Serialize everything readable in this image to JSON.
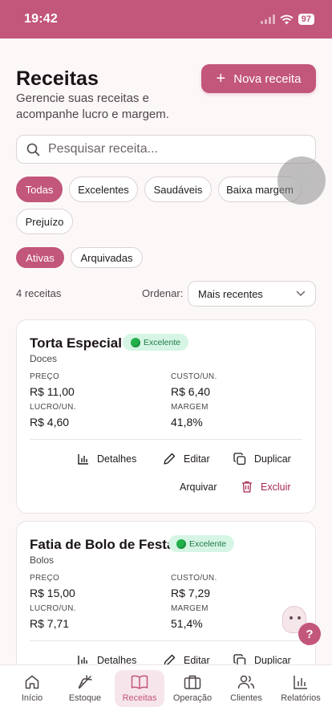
{
  "status_bar": {
    "time": "19:42",
    "battery": "97"
  },
  "header": {
    "title": "Receitas",
    "subtitle": "Gerencie suas receitas e acompanhe lucro e margem.",
    "new_button": "Nova receita"
  },
  "search": {
    "placeholder": "Pesquisar receita..."
  },
  "filters": [
    "Todas",
    "Excelentes",
    "Saudáveis",
    "Baixa margem",
    "Prejuízo"
  ],
  "active_filter": "Todas",
  "status_tabs": [
    "Ativas",
    "Arquivadas"
  ],
  "list": {
    "count": "4 receitas",
    "sort_label": "Ordenar:",
    "sort_value": "Mais recentes"
  },
  "cards": [
    {
      "name": "Torta Especial",
      "badge": "Excelente",
      "category": "Doces",
      "price_label": "PREÇO",
      "price": "R$ 11,00",
      "cost_label": "CUSTO/UN.",
      "cost": "R$ 6,40",
      "profit_label": "LUCRO/UN.",
      "profit": "R$ 4,60",
      "margin_label": "MARGEM",
      "margin": "41,8%"
    },
    {
      "name": "Fatia de Bolo de Festa",
      "badge": "Excelente",
      "category": "Bolos",
      "price_label": "PREÇO",
      "price": "R$ 15,00",
      "cost_label": "CUSTO/UN.",
      "cost": "R$ 7,29",
      "profit_label": "LUCRO/UN.",
      "profit": "R$ 7,71",
      "margin_label": "MARGEM",
      "margin": "51,4%"
    }
  ],
  "actions": {
    "details": "Detalhes",
    "edit": "Editar",
    "duplicate": "Duplicar",
    "archive": "Arquivar",
    "delete": "Excluir"
  },
  "help": "?",
  "bottom_nav": [
    {
      "label": "Início",
      "icon": "home-icon"
    },
    {
      "label": "Estoque",
      "icon": "carrot-icon"
    },
    {
      "label": "Receitas",
      "icon": "book-icon"
    },
    {
      "label": "Operação",
      "icon": "briefcase-icon"
    },
    {
      "label": "Clientes",
      "icon": "users-icon"
    },
    {
      "label": "Relatórios",
      "icon": "chart-icon"
    }
  ],
  "active_nav": "Receitas",
  "colors": {
    "primary": "#c2567b",
    "success_bg": "#d6f5e4",
    "success_text": "#1e7a47",
    "danger": "#a8284e"
  }
}
